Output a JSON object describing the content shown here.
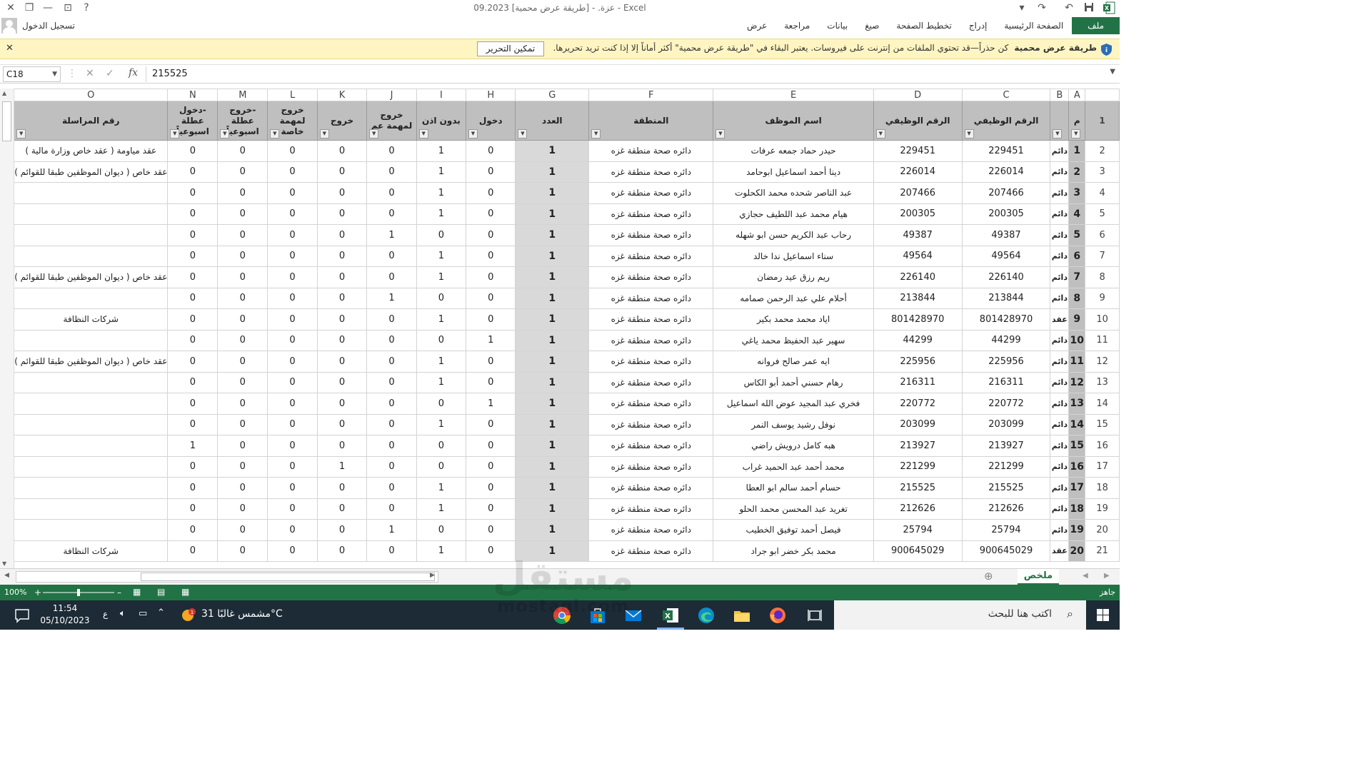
{
  "window": {
    "title": "09.2023 عزة. - [طريقة عرض محمية] - Excel",
    "signin": "تسجيل الدخول"
  },
  "ribbon": {
    "file": "ملف",
    "tabs": [
      "الصفحة الرئيسية",
      "إدراج",
      "تخطيط الصفحة",
      "صيغ",
      "بيانات",
      "مراجعة",
      "عرض"
    ]
  },
  "protected_view": {
    "label": "طريقة عرض محمية",
    "message": "كن حذراً—قد تحتوي الملفات من إنترنت على فيروسات. يعتبر البقاء في \"طريقة عرض محمية\" أكثر أماناً إلا إذا كنت تريد تحريرها.",
    "enable_button": "تمكين التحرير",
    "accent": "#fff5c2"
  },
  "formula_bar": {
    "name_box": "C18",
    "value": "215525",
    "fx": "fx"
  },
  "columns": [
    "A",
    "B",
    "C",
    "D",
    "E",
    "F",
    "G",
    "H",
    "I",
    "J",
    "K",
    "L",
    "M",
    "N",
    "O"
  ],
  "headers": {
    "A": "م",
    "B": "",
    "C": "الرقم الوظيفي",
    "D": "الرقم الوظيفي",
    "E": "اسم الموظف",
    "F": "المنطقة",
    "G": "العدد",
    "H": "دخول",
    "I": "بدون اذن",
    "J": "خروج لمهمة عم",
    "K": "خروج",
    "L": "خروج لمهمة خاصة",
    "M": "-خروج عطلة اسبوعياً",
    "N": "-دخول عطلة اسبوعياً",
    "O": "رقم المراسلة"
  },
  "rows": [
    {
      "r": "2",
      "A": "1",
      "B": "دائم",
      "C": "229451",
      "D": "229451",
      "E": "حيدر حماد جمعه عرفات",
      "F": "دائره صحة منطقة غزه",
      "G": "1",
      "H": "0",
      "I": "1",
      "J": "0",
      "K": "0",
      "L": "0",
      "M": "0",
      "N": "0",
      "O": "عقد مياومة ( عقد خاص وزارة مالية )"
    },
    {
      "r": "3",
      "A": "2",
      "B": "دائم",
      "C": "226014",
      "D": "226014",
      "E": "دينا أحمد اسماعيل ابوحامد",
      "F": "دائره صحة منطقة غزه",
      "G": "1",
      "H": "0",
      "I": "1",
      "J": "0",
      "K": "0",
      "L": "0",
      "M": "0",
      "N": "0",
      "O": "عقد خاص ( ديوان الموظفين طبقا للقوائم )"
    },
    {
      "r": "4",
      "A": "3",
      "B": "دائم",
      "C": "207466",
      "D": "207466",
      "E": "عبد الناصر شحده محمد الكحلوت",
      "F": "دائره صحة منطقة غزه",
      "G": "1",
      "H": "0",
      "I": "1",
      "J": "0",
      "K": "0",
      "L": "0",
      "M": "0",
      "N": "0",
      "O": ""
    },
    {
      "r": "5",
      "A": "4",
      "B": "دائم",
      "C": "200305",
      "D": "200305",
      "E": "هيام محمد عبد اللطيف حجازي",
      "F": "دائره صحة منطقة غزه",
      "G": "1",
      "H": "0",
      "I": "1",
      "J": "0",
      "K": "0",
      "L": "0",
      "M": "0",
      "N": "0",
      "O": ""
    },
    {
      "r": "6",
      "A": "5",
      "B": "دائم",
      "C": "49387",
      "D": "49387",
      "E": "رحاب عبد الكريم حسن ابو شهله",
      "F": "دائره صحة منطقة غزه",
      "G": "1",
      "H": "0",
      "I": "0",
      "J": "1",
      "K": "0",
      "L": "0",
      "M": "0",
      "N": "0",
      "O": ""
    },
    {
      "r": "7",
      "A": "6",
      "B": "دائم",
      "C": "49564",
      "D": "49564",
      "E": "سناء اسماعيل ندا خالد",
      "F": "دائره صحة منطقة غزه",
      "G": "1",
      "H": "0",
      "I": "1",
      "J": "0",
      "K": "0",
      "L": "0",
      "M": "0",
      "N": "0",
      "O": ""
    },
    {
      "r": "8",
      "A": "7",
      "B": "دائم",
      "C": "226140",
      "D": "226140",
      "E": "ريم رزق عيد رمضان",
      "F": "دائره صحة منطقة غزه",
      "G": "1",
      "H": "0",
      "I": "1",
      "J": "0",
      "K": "0",
      "L": "0",
      "M": "0",
      "N": "0",
      "O": "عقد خاص ( ديوان الموظفين طبقا للقوائم )"
    },
    {
      "r": "9",
      "A": "8",
      "B": "دائم",
      "C": "213844",
      "D": "213844",
      "E": "أحلام علي عبد الرحمن صمامه",
      "F": "دائره صحة منطقة غزه",
      "G": "1",
      "H": "0",
      "I": "0",
      "J": "1",
      "K": "0",
      "L": "0",
      "M": "0",
      "N": "0",
      "O": ""
    },
    {
      "r": "10",
      "A": "9",
      "B": "عقد",
      "C": "801428970",
      "D": "801428970",
      "E": "اياد محمد محمد بكير",
      "F": "دائره صحة منطقة غزه",
      "G": "1",
      "H": "0",
      "I": "1",
      "J": "0",
      "K": "0",
      "L": "0",
      "M": "0",
      "N": "0",
      "O": "شركات النظافة"
    },
    {
      "r": "11",
      "A": "10",
      "B": "دائم",
      "C": "44299",
      "D": "44299",
      "E": "سهير عبد الحفيظ محمد ياغي",
      "F": "دائره صحة منطقة غزه",
      "G": "1",
      "H": "1",
      "I": "0",
      "J": "0",
      "K": "0",
      "L": "0",
      "M": "0",
      "N": "0",
      "O": ""
    },
    {
      "r": "12",
      "A": "11",
      "B": "دائم",
      "C": "225956",
      "D": "225956",
      "E": "ايه عمر صالح فروانه",
      "F": "دائره صحة منطقة غزه",
      "G": "1",
      "H": "0",
      "I": "1",
      "J": "0",
      "K": "0",
      "L": "0",
      "M": "0",
      "N": "0",
      "O": "عقد خاص ( ديوان الموظفين طبقا للقوائم )"
    },
    {
      "r": "13",
      "A": "12",
      "B": "دائم",
      "C": "216311",
      "D": "216311",
      "E": "رهام حسني أحمد أبو الكاس",
      "F": "دائره صحة منطقة غزه",
      "G": "1",
      "H": "0",
      "I": "1",
      "J": "0",
      "K": "0",
      "L": "0",
      "M": "0",
      "N": "0",
      "O": ""
    },
    {
      "r": "14",
      "A": "13",
      "B": "دائم",
      "C": "220772",
      "D": "220772",
      "E": "فخري عبد المجيد عوض الله اسماعيل",
      "F": "دائره صحة منطقة غزه",
      "G": "1",
      "H": "1",
      "I": "0",
      "J": "0",
      "K": "0",
      "L": "0",
      "M": "0",
      "N": "0",
      "O": ""
    },
    {
      "r": "15",
      "A": "14",
      "B": "دائم",
      "C": "203099",
      "D": "203099",
      "E": "نوفل رشيد يوسف النمر",
      "F": "دائره صحة منطقة غزه",
      "G": "1",
      "H": "0",
      "I": "1",
      "J": "0",
      "K": "0",
      "L": "0",
      "M": "0",
      "N": "0",
      "O": ""
    },
    {
      "r": "16",
      "A": "15",
      "B": "دائم",
      "C": "213927",
      "D": "213927",
      "E": "هبه كامل درويش راضي",
      "F": "دائره صحة منطقة غزه",
      "G": "1",
      "H": "0",
      "I": "0",
      "J": "0",
      "K": "0",
      "L": "0",
      "M": "0",
      "N": "1",
      "O": ""
    },
    {
      "r": "17",
      "A": "16",
      "B": "دائم",
      "C": "221299",
      "D": "221299",
      "E": "محمد أحمد عبد الحميد غراب",
      "F": "دائره صحة منطقة غزه",
      "G": "1",
      "H": "0",
      "I": "0",
      "J": "0",
      "K": "1",
      "L": "0",
      "M": "0",
      "N": "0",
      "O": ""
    },
    {
      "r": "18",
      "A": "17",
      "B": "دائم",
      "C": "215525",
      "D": "215525",
      "E": "حسام أحمد سالم ابو العطا",
      "F": "دائره صحة منطقة غزه",
      "G": "1",
      "H": "0",
      "I": "1",
      "J": "0",
      "K": "0",
      "L": "0",
      "M": "0",
      "N": "0",
      "O": ""
    },
    {
      "r": "19",
      "A": "18",
      "B": "دائم",
      "C": "212626",
      "D": "212626",
      "E": "تغريد عبد المحسن محمد الحلو",
      "F": "دائره صحة منطقة غزه",
      "G": "1",
      "H": "0",
      "I": "1",
      "J": "0",
      "K": "0",
      "L": "0",
      "M": "0",
      "N": "0",
      "O": ""
    },
    {
      "r": "20",
      "A": "19",
      "B": "دائم",
      "C": "25794",
      "D": "25794",
      "E": "فيصل أحمد توفيق الخطيب",
      "F": "دائره صحة منطقة غزه",
      "G": "1",
      "H": "0",
      "I": "0",
      "J": "1",
      "K": "0",
      "L": "0",
      "M": "0",
      "N": "0",
      "O": ""
    },
    {
      "r": "21",
      "A": "20",
      "B": "عقد",
      "C": "900645029",
      "D": "900645029",
      "E": "محمد بكر خضر ابو جراد",
      "F": "دائره صحة منطقة غزه",
      "G": "1",
      "H": "0",
      "I": "1",
      "J": "0",
      "K": "0",
      "L": "0",
      "M": "0",
      "N": "0",
      "O": "شركات النظافة"
    }
  ],
  "sheet_tabs": [
    "ملخص"
  ],
  "status": {
    "ready": "جاهز",
    "zoom": "100%"
  },
  "taskbar": {
    "search_placeholder": "اكتب هنا للبحث",
    "weather": "مشمس غالبًا  31°C",
    "time": "11:54",
    "date": "05/10/2023",
    "lang": "ع",
    "weather_badge": "1"
  },
  "watermark": {
    "brand": "مستقل",
    "url": "mostaql.com"
  },
  "colors": {
    "excel_green": "#217346",
    "header_gray": "#bfbfbf",
    "taskbar": "#1c2b36"
  }
}
